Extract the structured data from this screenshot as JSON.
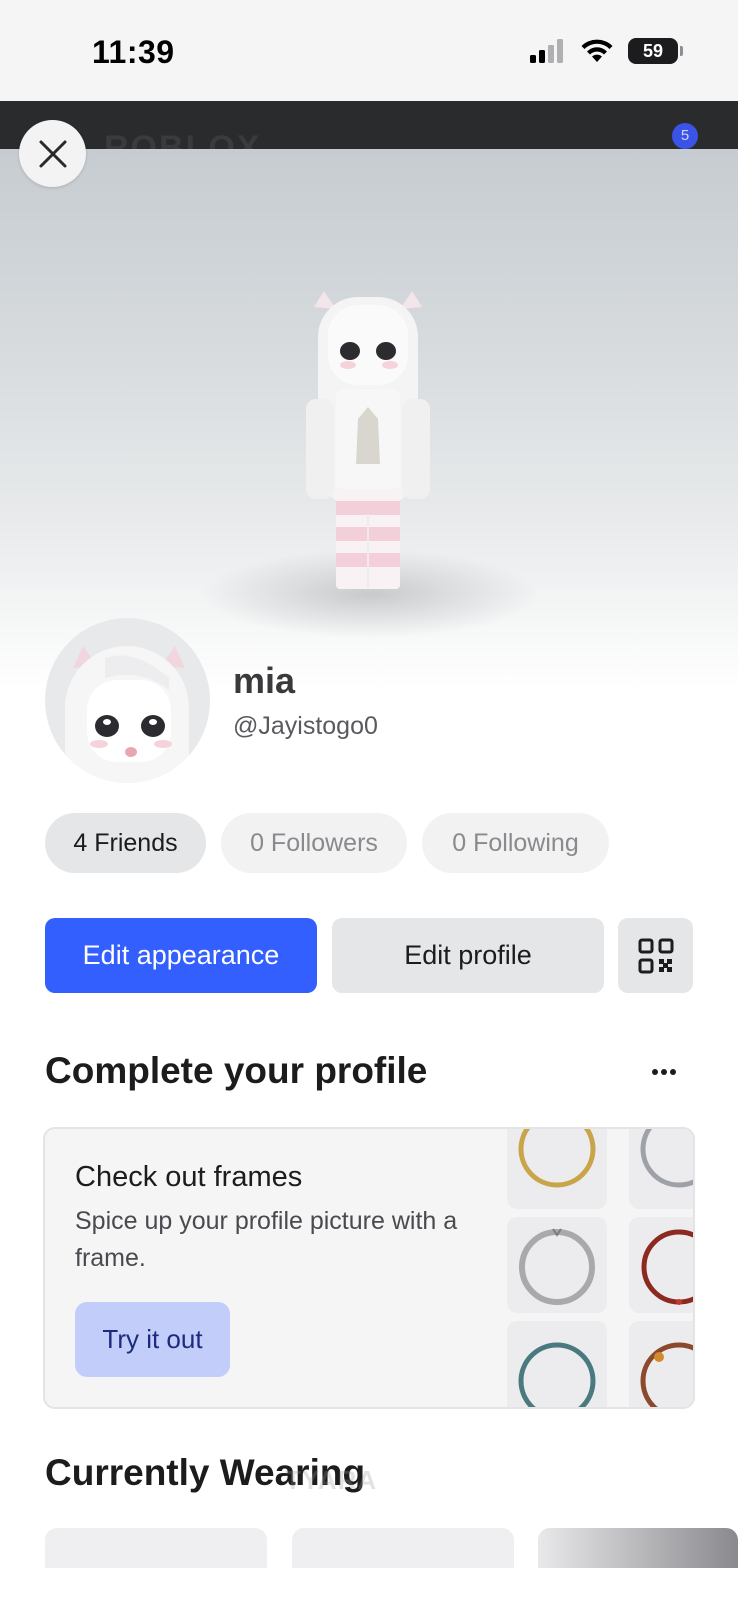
{
  "status_bar": {
    "time": "11:39",
    "battery": "59",
    "icons": [
      "cellular-signal-icon",
      "wifi-icon",
      "battery-icon"
    ]
  },
  "app_bar": {
    "logo": "ROBLOX",
    "notification_count": "5"
  },
  "header": {
    "close_icon": "close-icon"
  },
  "profile": {
    "display_name": "mia",
    "username": "@Jayistogo0"
  },
  "stats": [
    {
      "label": "4 Friends",
      "active": true
    },
    {
      "label": "0 Followers",
      "active": false
    },
    {
      "label": "0 Following",
      "active": false
    }
  ],
  "actions": {
    "edit_appearance": "Edit appearance",
    "edit_profile": "Edit profile",
    "qr_icon": "qr-code-icon"
  },
  "complete_profile": {
    "title": "Complete your profile",
    "more_icon": "more-horizontal-icon",
    "card": {
      "title": "Check out frames",
      "description": "Spice up your profile picture with a frame.",
      "button": "Try it out",
      "frames": [
        "gold",
        "silver",
        "silver-star",
        "red-gem",
        "teal",
        "orange-gem"
      ]
    }
  },
  "currently_wearing": {
    "title": "Currently Wearing"
  },
  "watermark": "TYARA",
  "colors": {
    "primary": "#335fff",
    "secondary_bg": "#e5e6e8",
    "try_button_bg": "#c3cdfa",
    "try_button_text": "#1b2c80"
  }
}
